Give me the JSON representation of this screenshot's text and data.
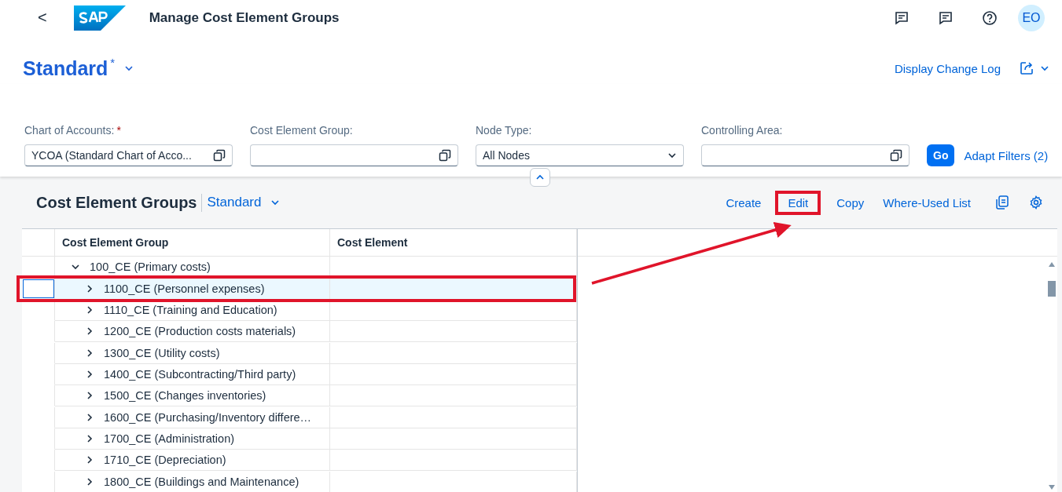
{
  "shell": {
    "back": "<",
    "title": "Manage Cost Element Groups",
    "avatar": "EO"
  },
  "variant": {
    "name": "Standard",
    "modified": "*",
    "action": "Display Change Log"
  },
  "filters": [
    {
      "kind": "valuehelp",
      "label": "Chart of Accounts:",
      "required": true,
      "value": "YCOA (Standard Chart of Acco..."
    },
    {
      "kind": "valuehelp",
      "label": "Cost Element Group:",
      "required": false
    },
    {
      "kind": "select",
      "label": "Node Type:",
      "required": false,
      "value": "All Nodes"
    },
    {
      "kind": "valuehelp",
      "label": "Controlling Area:",
      "required": false
    }
  ],
  "filter_buttons": {
    "go": "Go",
    "adapt": "Adapt Filters (2)"
  },
  "table": {
    "title": "Cost Element Groups",
    "variant": "Standard",
    "actions": [
      {
        "label": "Create",
        "highlighted": false
      },
      {
        "label": "Edit",
        "highlighted": true
      },
      {
        "label": "Copy",
        "highlighted": false
      },
      {
        "label": "Where-Used List",
        "highlighted": false
      }
    ],
    "columns": [
      "Cost Element Group",
      "Cost Element"
    ],
    "rows": [
      {
        "label": "100_CE (Primary costs)",
        "expanded": true,
        "selected": false,
        "highlighted": false,
        "children": [
          {
            "label": "1100_CE (Personnel expenses)",
            "expanded": false,
            "selected": true,
            "highlighted": true
          },
          {
            "label": "1110_CE (Training and Education)",
            "expanded": false,
            "selected": false,
            "highlighted": false
          },
          {
            "label": "1200_CE (Production costs materials)",
            "expanded": false,
            "selected": false,
            "highlighted": false
          },
          {
            "label": "1300_CE (Utility costs)",
            "expanded": false,
            "selected": false,
            "highlighted": false
          },
          {
            "label": "1400_CE (Subcontracting/Third party)",
            "expanded": false,
            "selected": false,
            "highlighted": false
          },
          {
            "label": "1500_CE (Changes inventories)",
            "expanded": false,
            "selected": false,
            "highlighted": false
          },
          {
            "label": "1600_CE (Purchasing/Inventory differe…",
            "expanded": false,
            "selected": false,
            "highlighted": false
          },
          {
            "label": "1700_CE (Administration)",
            "expanded": false,
            "selected": false,
            "highlighted": false
          },
          {
            "label": "1710_CE (Depreciation)",
            "expanded": false,
            "selected": false,
            "highlighted": false
          },
          {
            "label": "1800_CE (Buildings and Maintenance)",
            "expanded": false,
            "selected": false,
            "highlighted": false
          }
        ]
      }
    ]
  }
}
